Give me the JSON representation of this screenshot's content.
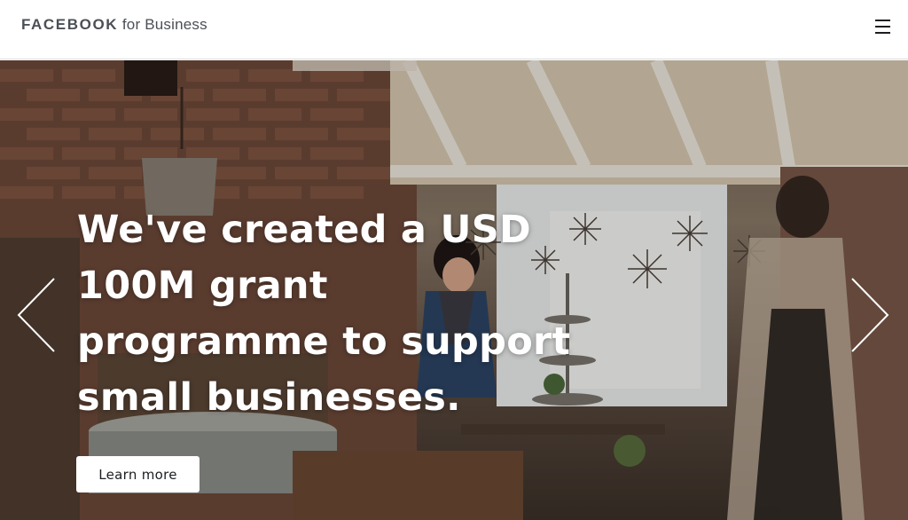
{
  "header": {
    "brand": "FACEBOOK",
    "brand_suffix": "for Business",
    "menu_icon": "hamburger-menu-icon"
  },
  "hero": {
    "headline": "We've created a USD 100M grant programme to support small businesses.",
    "cta_label": "Learn more",
    "prev_icon": "chevron-left-icon",
    "next_icon": "chevron-right-icon"
  },
  "colors": {
    "header_bg": "#ffffff",
    "brand_text": "#4b4f56",
    "headline_text": "#ffffff",
    "button_bg": "#ffffff",
    "button_text": "#1c1e21"
  }
}
